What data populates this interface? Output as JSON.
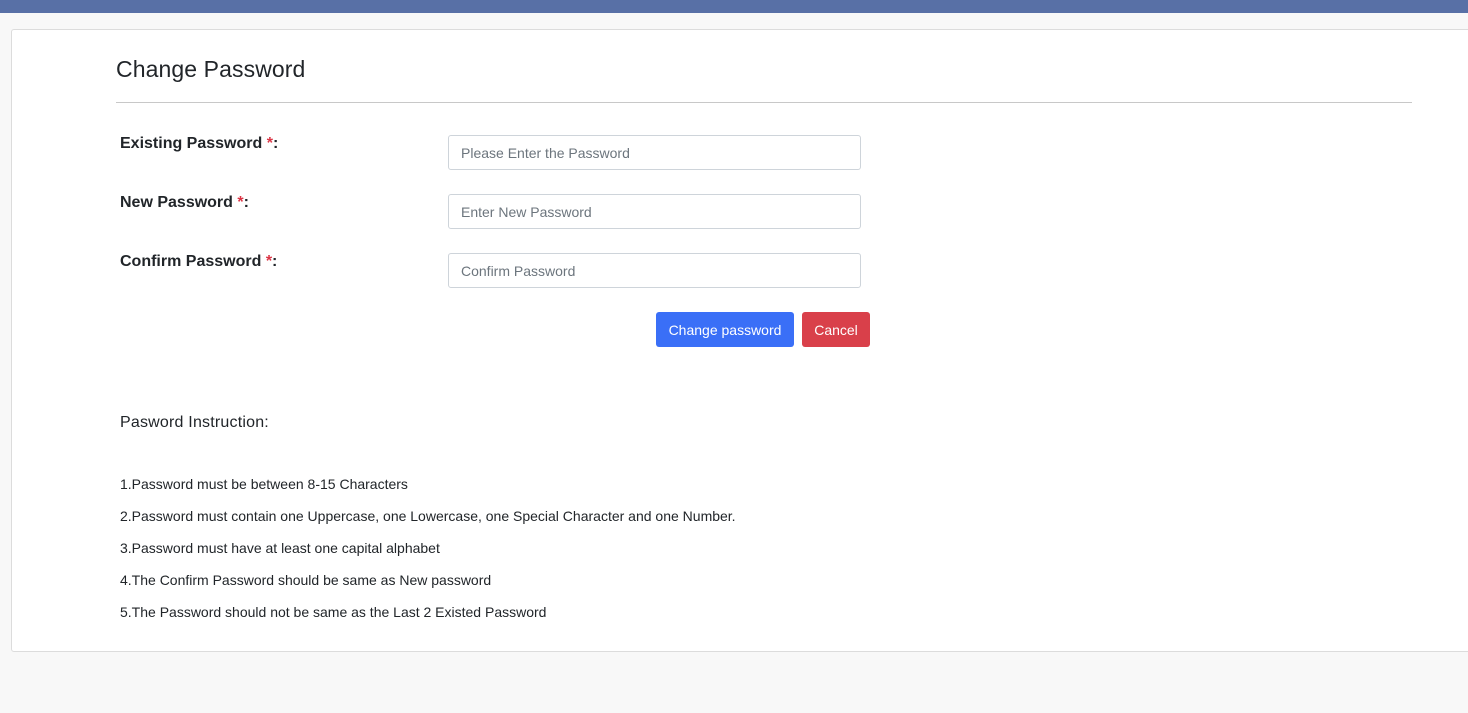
{
  "header": {
    "accent_color": "#5870a6"
  },
  "form": {
    "title": "Change Password",
    "fields": [
      {
        "label": "Existing Password ",
        "required_mark": "*",
        "suffix": ":",
        "placeholder": "Please Enter the Password",
        "value": ""
      },
      {
        "label": "New Password ",
        "required_mark": "*",
        "suffix": ":",
        "placeholder": "Enter New Password",
        "value": ""
      },
      {
        "label": "Confirm Password ",
        "required_mark": "*",
        "suffix": ":",
        "placeholder": "Confirm Password",
        "value": ""
      }
    ],
    "submit_label": "Change password",
    "cancel_label": "Cancel",
    "submit_color": "#3a6ff7",
    "cancel_color": "#d9404a",
    "required_color": "#dc3545"
  },
  "instructions": {
    "title": "Pasword Instruction:",
    "items": [
      "1.Password must be between 8-15 Characters",
      "2.Password must contain one Uppercase, one Lowercase, one Special Character and one Number.",
      "3.Password must have at least one capital alphabet",
      "4.The Confirm Password should be same as New password",
      "5.The Password should not be same as the Last 2 Existed Password"
    ]
  }
}
